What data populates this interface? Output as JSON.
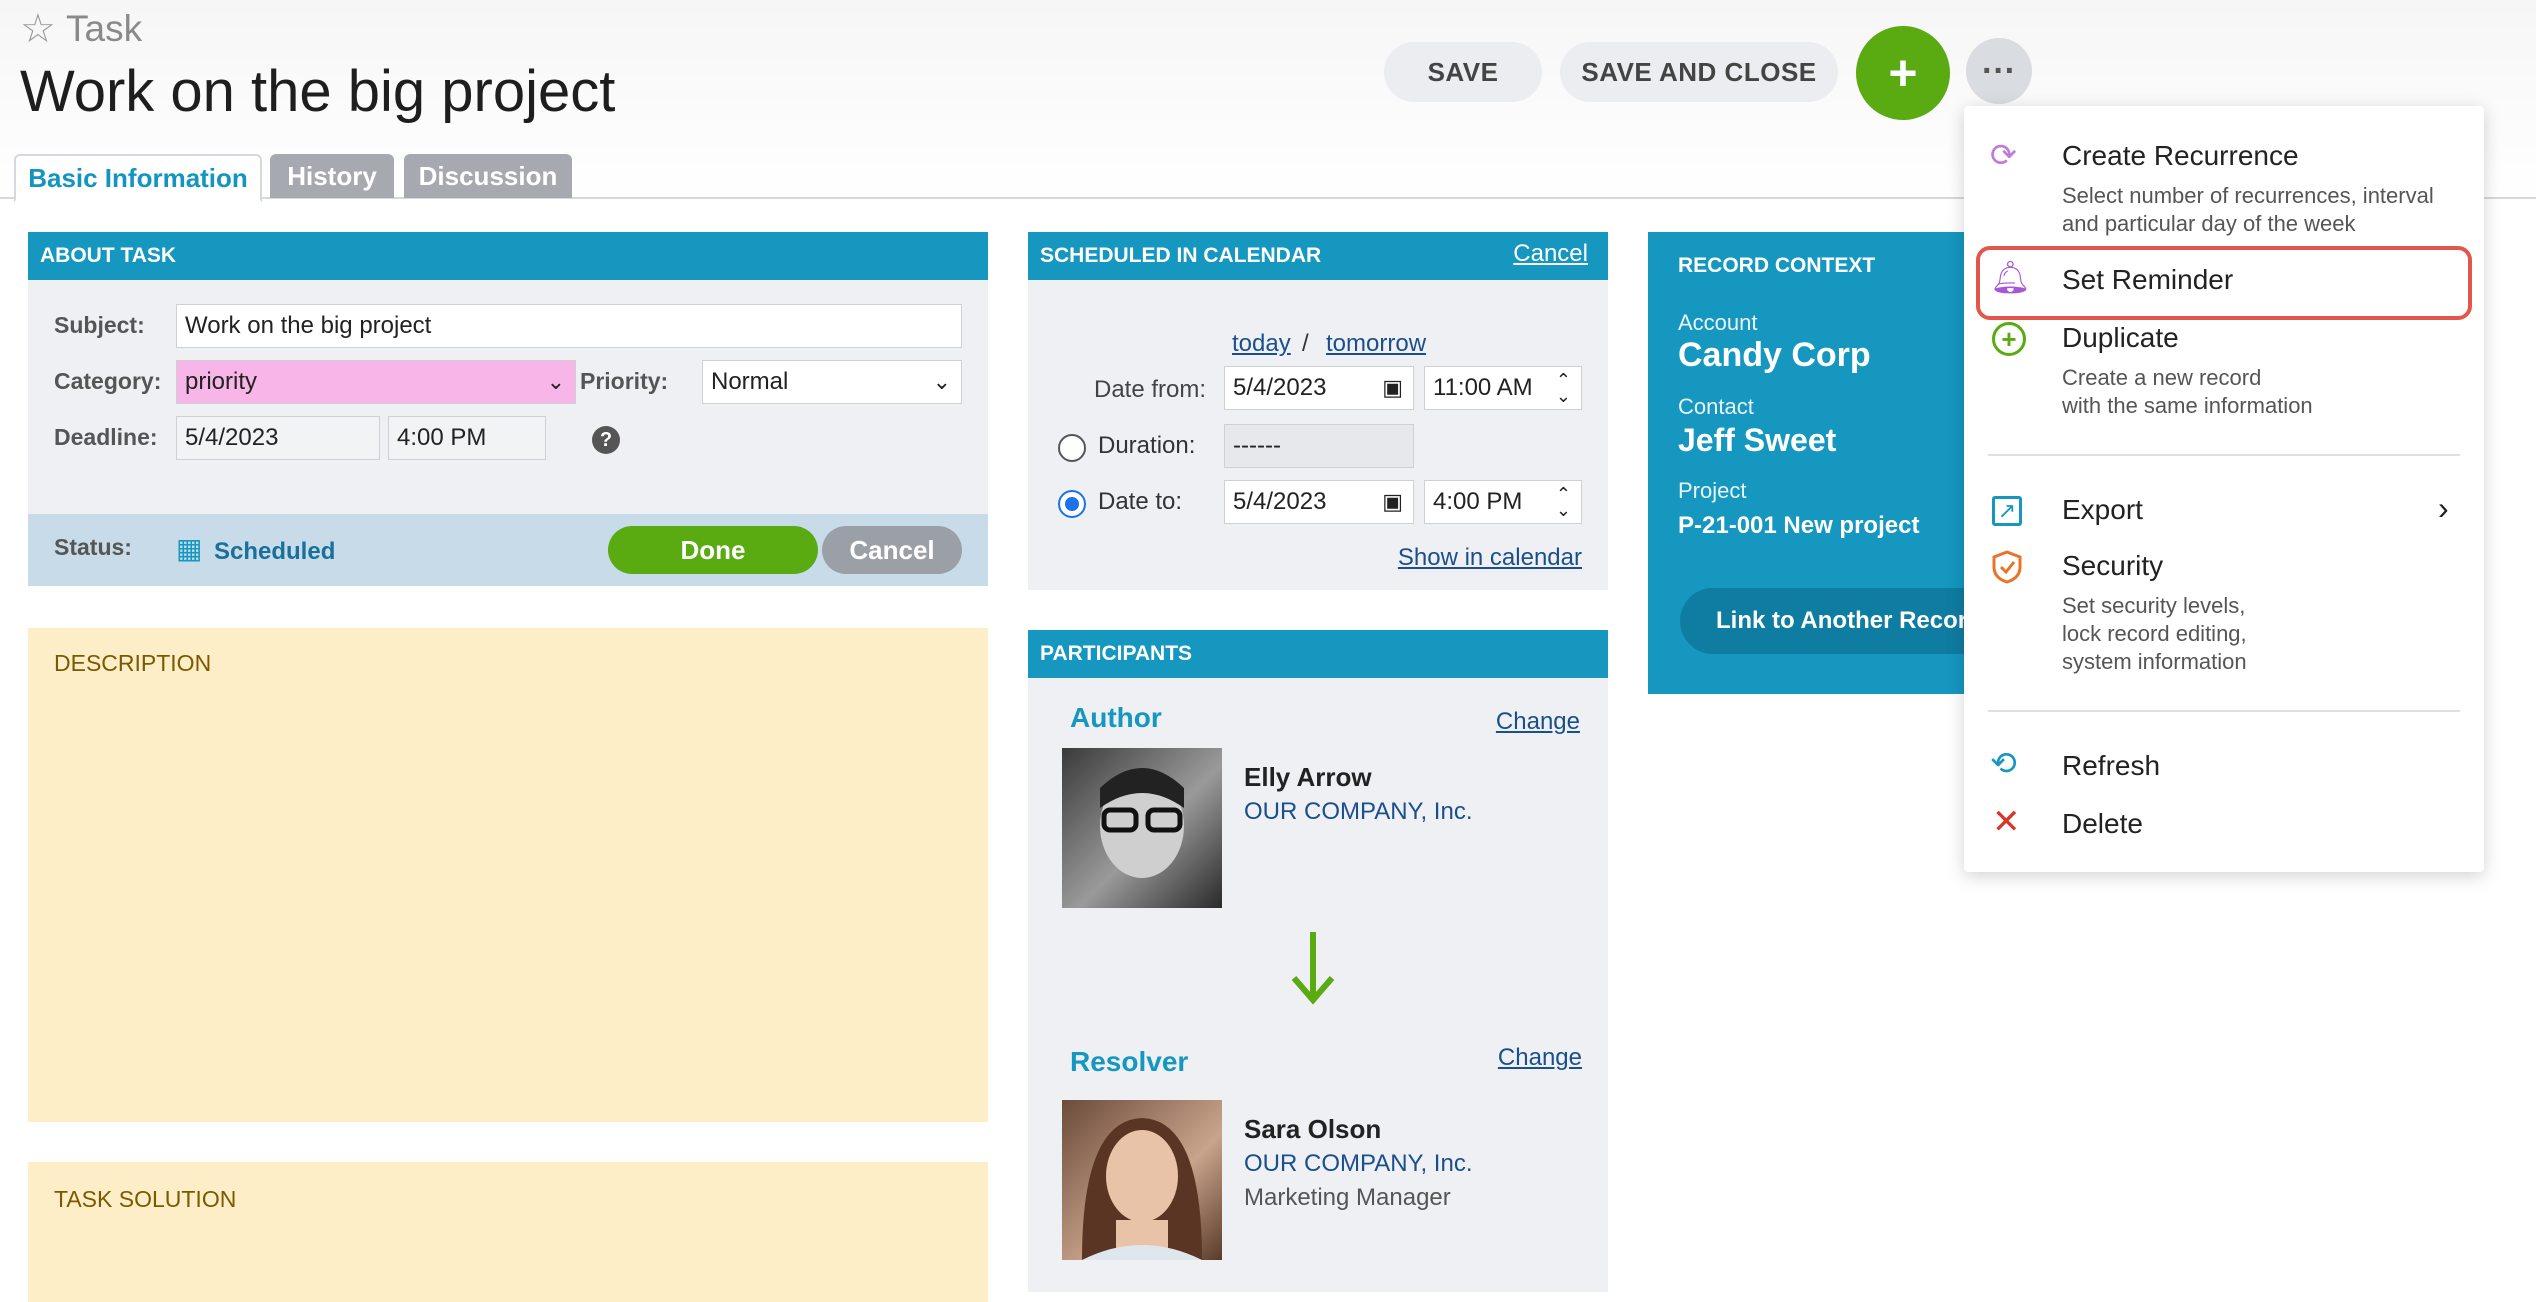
{
  "header": {
    "breadcrumb": "Task",
    "title": "Work on the big project",
    "save_label": "SAVE",
    "save_close_label": "SAVE AND CLOSE",
    "add_symbol": "+",
    "more_symbol": "···"
  },
  "tabs": [
    {
      "label": "Basic Information",
      "active": true
    },
    {
      "label": "History",
      "active": false
    },
    {
      "label": "Discussion",
      "active": false
    }
  ],
  "about": {
    "heading": "ABOUT TASK",
    "subject_label": "Subject:",
    "subject_value": "Work on the big project",
    "category_label": "Category:",
    "category_value": "priority",
    "priority_label": "Priority:",
    "priority_value": "Normal",
    "deadline_label": "Deadline:",
    "deadline_date": "5/4/2023",
    "deadline_time": "4:00 PM",
    "help": "?",
    "status_label": "Status:",
    "status_value": "Scheduled",
    "done_label": "Done",
    "cancel_label": "Cancel"
  },
  "description": {
    "heading": "DESCRIPTION"
  },
  "solution": {
    "heading": "TASK SOLUTION"
  },
  "calendar": {
    "heading": "SCHEDULED IN CALENDAR",
    "cancel_link": "Cancel",
    "today": "today",
    "slash": "/",
    "tomorrow": "tomorrow",
    "date_from_label": "Date from:",
    "date_from": "5/4/2023",
    "time_from": "11:00 AM",
    "duration_label": "Duration:",
    "duration_value": "------",
    "date_to_label": "Date to:",
    "date_to": "5/4/2023",
    "time_to": "4:00 PM",
    "show_link": "Show in calendar"
  },
  "participants": {
    "heading": "PARTICIPANTS",
    "author_label": "Author",
    "author_change": "Change",
    "author_name": "Elly Arrow",
    "author_company": "OUR COMPANY, Inc.",
    "resolver_label": "Resolver",
    "resolver_change": "Change",
    "resolver_name": "Sara Olson",
    "resolver_company": "OUR COMPANY, Inc.",
    "resolver_role": "Marketing Manager"
  },
  "context": {
    "heading": "RECORD CONTEXT",
    "account_label": "Account",
    "account_value": "Candy Corp",
    "contact_label": "Contact",
    "contact_value": "Jeff Sweet",
    "project_label": "Project",
    "project_value": "P-21-001 New project",
    "link_button": "Link to Another Record"
  },
  "menu": {
    "items": [
      {
        "title": "Create Recurrence",
        "sub1": "Select number of recurrences, interval",
        "sub2": "and particular day of the week"
      },
      {
        "title": "Set Reminder"
      },
      {
        "title": "Duplicate",
        "sub1": "Create a new record",
        "sub2": "with the same information"
      },
      {
        "title": "Export"
      },
      {
        "title": "Security",
        "sub1": "Set security levels,",
        "sub2": "lock record editing,",
        "sub3": "system information"
      },
      {
        "title": "Refresh"
      },
      {
        "title": "Delete"
      }
    ]
  },
  "colors": {
    "accent": "#1597c0",
    "green": "#5aaa12",
    "highlight": "#e2574c",
    "category_bg": "#f8b5e8"
  }
}
